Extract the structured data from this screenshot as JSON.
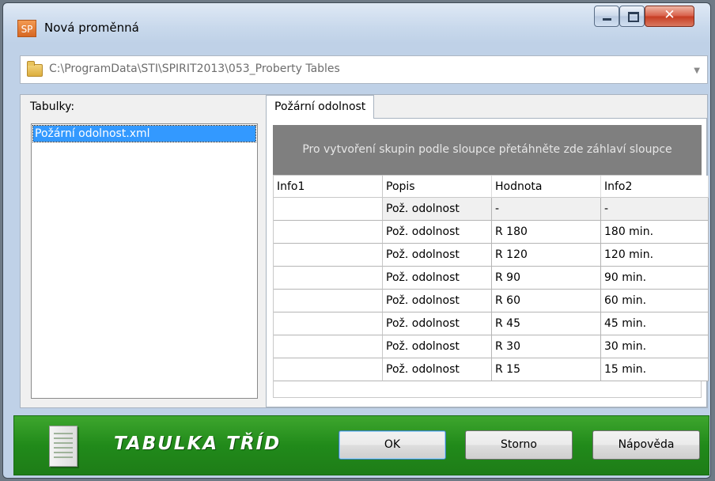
{
  "window": {
    "title": "Nová proměnná",
    "app_icon": "SP"
  },
  "path": {
    "value": "C:\\ProgramData\\STI\\SPIRIT2013\\053_Proberty Tables"
  },
  "left": {
    "label": "Tabulky:",
    "items": [
      "Požární odolnost.xml"
    ]
  },
  "tab": {
    "label": "Požární odolnost"
  },
  "grid": {
    "group_hint": "Pro vytvoření skupin podle sloupce přetáhněte zde záhlaví sloupce",
    "columns": [
      "Info1",
      "Popis",
      "Hodnota",
      "Info2"
    ],
    "rows": [
      [
        "",
        "Pož. odolnost",
        "-",
        "-"
      ],
      [
        "",
        "Pož. odolnost",
        "R 180",
        "180 min."
      ],
      [
        "",
        "Pož. odolnost",
        "R 120",
        "120 min."
      ],
      [
        "",
        "Pož. odolnost",
        "R 90",
        "90 min."
      ],
      [
        "",
        "Pož. odolnost",
        "R 60",
        "60 min."
      ],
      [
        "",
        "Pož. odolnost",
        "R 45",
        "45 min."
      ],
      [
        "",
        "Pož. odolnost",
        "R 30",
        "30 min."
      ],
      [
        "",
        "Pož. odolnost",
        "R 15",
        "15 min."
      ]
    ]
  },
  "footer": {
    "title": "TABULKA TŘÍD",
    "ok_label": "OK",
    "cancel_label": "Storno",
    "help_label": "Nápověda"
  },
  "colors": {
    "footer_green": "#218a1a",
    "selection": "#3399ff",
    "group_header": "#7f7f7f"
  }
}
